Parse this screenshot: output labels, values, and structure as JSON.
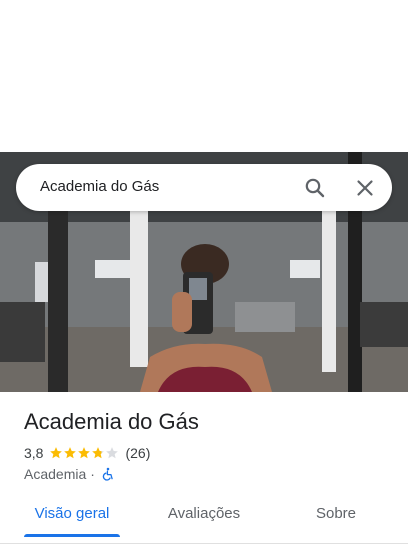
{
  "search": {
    "query": "Academia do Gás",
    "search_icon": "search-icon",
    "close_icon": "close-icon"
  },
  "place": {
    "name": "Academia do Gás",
    "rating": "3,8",
    "rating_value": 3.8,
    "stars_max": 5,
    "review_count": "(26)",
    "category": "Academia",
    "separator": "·",
    "accessibility_icon": "wheelchair-accessible-icon"
  },
  "tabs": [
    {
      "label": "Visão geral",
      "active": true
    },
    {
      "label": "Avaliações",
      "active": false
    },
    {
      "label": "Sobre",
      "active": false
    }
  ],
  "colors": {
    "accent": "#1a73e8",
    "star": "#fbbc04",
    "star_empty": "#dadce0",
    "text_primary": "#202124",
    "text_secondary": "#5f6368"
  }
}
